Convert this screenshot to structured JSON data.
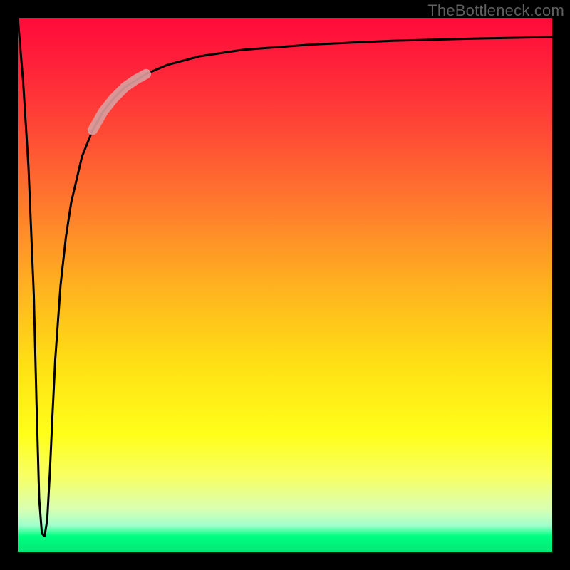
{
  "attribution": "TheBottleneck.com",
  "colors": {
    "frame": "#000000",
    "curve": "#000000",
    "highlight": "#d9a0a0",
    "gradient_top": "#ff0a3a",
    "gradient_bottom": "#00e676"
  },
  "chart_data": {
    "type": "line",
    "title": "",
    "xlabel": "",
    "ylabel": "",
    "xlim": [
      0,
      100
    ],
    "ylim": [
      0,
      100
    ],
    "grid": false,
    "note": "y-axis is inverted in rendering (0 at top, larger values toward bottom then back up); values here are the visual vertical position in percent-from-top for readability of the spike/asymptote shape.",
    "series": [
      {
        "name": "main-curve",
        "x": [
          0.0,
          1.0,
          2.0,
          3.0,
          3.5,
          4.0,
          4.5,
          5.0,
          5.5,
          6.0,
          6.5,
          7.0,
          8.0,
          9.0,
          10.0,
          12.0,
          14.0,
          16.0,
          18.0,
          20.0,
          24.0,
          28.0,
          34.0,
          42.0,
          55.0,
          70.0,
          85.0,
          100.0
        ],
        "y": [
          0.0,
          12.0,
          28.0,
          52.0,
          72.0,
          90.0,
          96.5,
          97.0,
          94.0,
          85.0,
          74.0,
          64.0,
          50.0,
          41.0,
          34.5,
          26.0,
          21.0,
          17.5,
          15.0,
          13.0,
          10.5,
          8.8,
          7.2,
          6.0,
          5.0,
          4.3,
          3.9,
          3.6
        ]
      },
      {
        "name": "highlight-segment",
        "x": [
          14.0,
          16.0,
          18.0,
          20.0,
          22.0,
          24.0
        ],
        "y": [
          21.0,
          17.5,
          15.0,
          13.0,
          11.6,
          10.5
        ]
      }
    ]
  }
}
